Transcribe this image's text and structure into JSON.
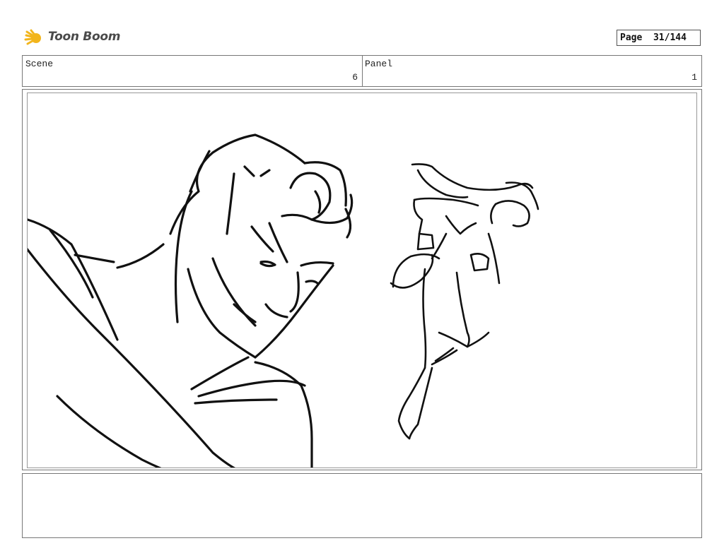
{
  "header": {
    "logo_text": "Toon Boom",
    "page_label": "Page",
    "page_number": "31/144"
  },
  "scene": {
    "label": "Scene",
    "value": "6"
  },
  "panel": {
    "label": "Panel",
    "value": "1"
  },
  "colors": {
    "logo_sun": "#f2b51c",
    "border": "#777777",
    "ink": "#111111"
  },
  "notes": {
    "text": ""
  }
}
